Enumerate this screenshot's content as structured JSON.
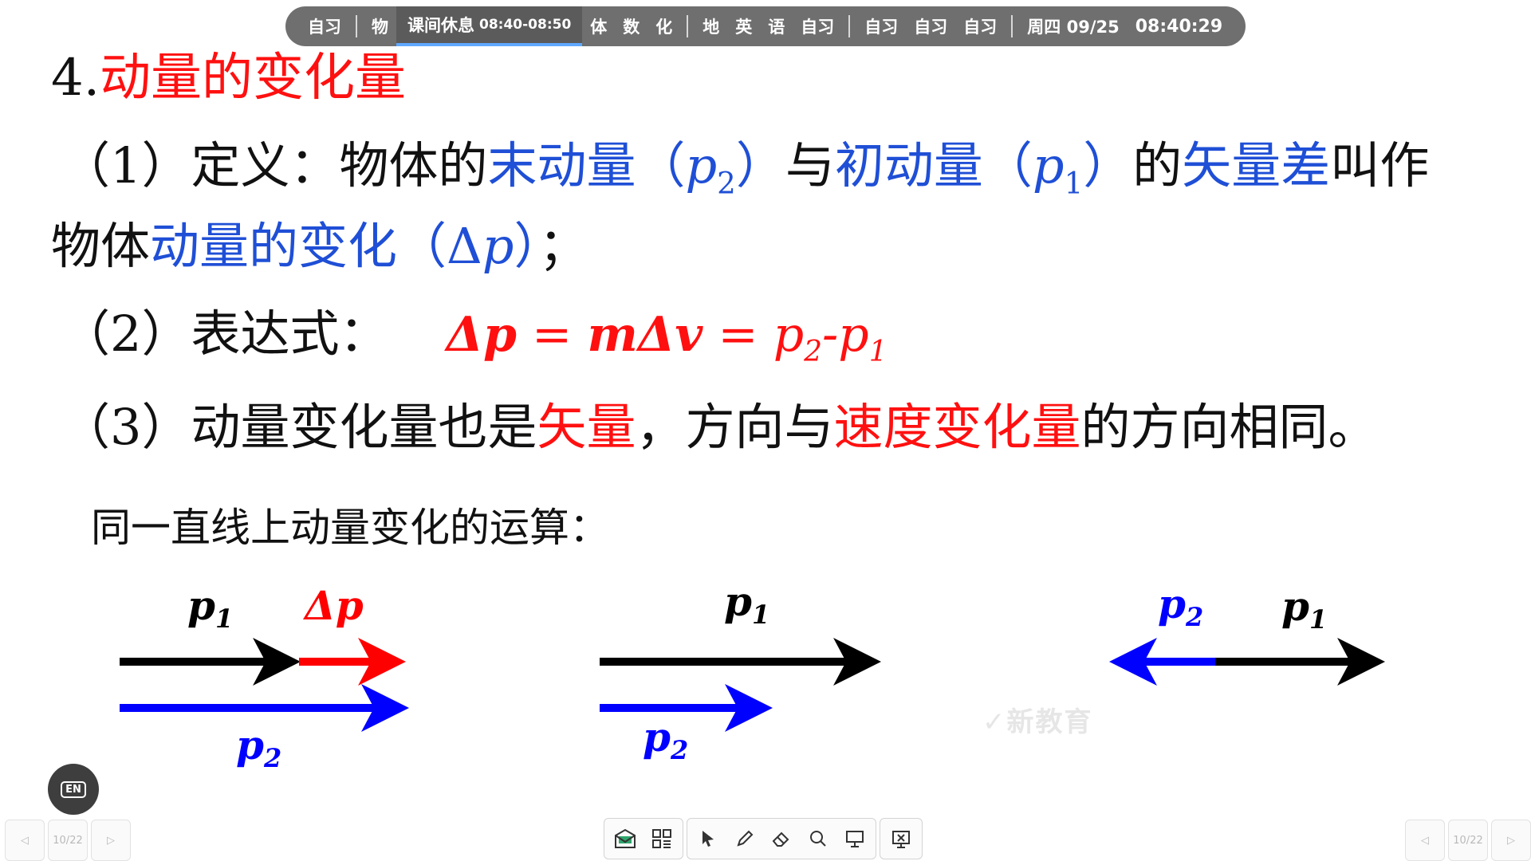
{
  "schedule_bar": {
    "items_before": [
      "自习",
      "物"
    ],
    "current": {
      "label": "课间休息",
      "time": "08:40-08:50"
    },
    "items_group2": [
      "体",
      "数",
      "化"
    ],
    "items_group3": [
      "地",
      "英",
      "语",
      "自习"
    ],
    "items_group4": [
      "自习",
      "自习",
      "自习"
    ],
    "date": "周四 09/25",
    "clock": "08:40:29",
    "accent_color": "#5fa8ff"
  },
  "slide": {
    "heading_number": "4.",
    "heading_title": "动量的变化量",
    "def": {
      "prefix": "（1）定义：物体的",
      "term_final": "末动量（",
      "p2": "p",
      "p2_sub": "2",
      "close1": "）",
      "connector": "与",
      "term_initial": "初动量（",
      "p1": "p",
      "p1_sub": "1",
      "close2": "）",
      "connector2": "的",
      "vector_diff": "矢量差",
      "suffix": "叫作"
    },
    "def_line2": {
      "prefix": "物体",
      "term_change": "动量的变化（Δ",
      "dp": "p",
      "close": "）",
      "end": "；"
    },
    "expr": {
      "prefix": "（2）表达式：",
      "formula_a": "Δp",
      "eq1": " = ",
      "formula_b": "mΔv",
      "eq2": "  = p",
      "sub2": "2",
      "minus": "-p",
      "sub1": "1"
    },
    "prop": {
      "prefix": "（3）动量变化量也是",
      "vector": "矢量",
      "middle": "，方向与",
      "vel_change": "速度变化量",
      "suffix": "的方向相同。"
    },
    "subheading": "同一直线上动量变化的运算："
  },
  "diagrams": {
    "d1": {
      "p1": "p",
      "p1_sub": "1",
      "dp": "Δp",
      "p2": "p",
      "p2_sub": "2"
    },
    "d2": {
      "p1": "p",
      "p1_sub": "1",
      "p2": "p",
      "p2_sub": "2"
    },
    "d3": {
      "p2": "p",
      "p2_sub": "2",
      "p1": "p",
      "p1_sub": "1"
    },
    "colors": {
      "p1": "#000000",
      "p2": "#0000ff",
      "dp": "#ff0000"
    }
  },
  "watermark": "新教育",
  "en_button": "EN",
  "pager_left": {
    "page": "10/22"
  },
  "pager_right": {
    "page": "10/22"
  },
  "toolbar_icons": [
    "whiteboard-icon",
    "apps-grid-icon",
    "pointer-icon",
    "pen-icon",
    "eraser-icon",
    "search-icon",
    "screen-icon",
    "close-presentation-icon"
  ]
}
